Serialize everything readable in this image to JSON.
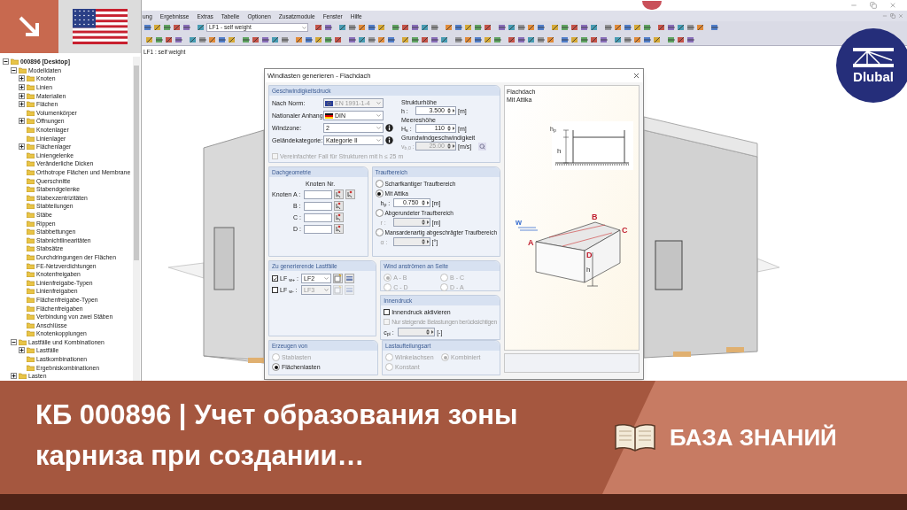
{
  "menu": [
    "ung",
    "Ergebnisse",
    "Extras",
    "Tabelle",
    "Optionen",
    "Zusatzmodule",
    "Fenster",
    "Hilfe"
  ],
  "load_case_select": "LF1 - self weight",
  "view_label": "LF1 : self weight",
  "tree": [
    {
      "label": "000896 [Desktop]",
      "expanded": true,
      "children": [
        {
          "label": "Modelldaten",
          "expanded": true,
          "children": [
            {
              "label": "Knoten",
              "expanded": false
            },
            {
              "label": "Linien",
              "expanded": false
            },
            {
              "label": "Materialien",
              "expanded": false
            },
            {
              "label": "Flächen",
              "expanded": false
            },
            {
              "label": "Volumenkörper"
            },
            {
              "label": "Öffnungen",
              "expanded": false
            },
            {
              "label": "Knotenlager"
            },
            {
              "label": "Linienlager"
            },
            {
              "label": "Flächenlager",
              "expanded": false
            },
            {
              "label": "Liniengelenke"
            },
            {
              "label": "Veränderliche Dicken"
            },
            {
              "label": "Orthotrope Flächen und Membrane"
            },
            {
              "label": "Querschnitte"
            },
            {
              "label": "Stabendgelenke"
            },
            {
              "label": "Stabexzentrizitäten"
            },
            {
              "label": "Stabteilungen"
            },
            {
              "label": "Stäbe"
            },
            {
              "label": "Rippen"
            },
            {
              "label": "Stabbettungen"
            },
            {
              "label": "Stabnichtlinearitäten"
            },
            {
              "label": "Stabsätze"
            },
            {
              "label": "Durchdringungen der Flächen"
            },
            {
              "label": "FE-Netzverdichtungen"
            },
            {
              "label": "Knotenfreigaben"
            },
            {
              "label": "Linienfreigabe-Typen"
            },
            {
              "label": "Linienfreigaben"
            },
            {
              "label": "Flächenfreigabe-Typen"
            },
            {
              "label": "Flächenfreigaben"
            },
            {
              "label": "Verbindung von zwei Stäben"
            },
            {
              "label": "Anschlüsse"
            },
            {
              "label": "Knotenkopplungen"
            }
          ]
        },
        {
          "label": "Lastfälle und Kombinationen",
          "expanded": true,
          "children": [
            {
              "label": "Lastfälle",
              "expanded": false
            },
            {
              "label": "Lastkombinationen"
            },
            {
              "label": "Ergebniskombinationen"
            }
          ]
        },
        {
          "label": "Lasten",
          "expanded": false
        }
      ]
    }
  ],
  "dialog": {
    "title": "Windlasten generieren  -  Flachdach",
    "speed_pressure": {
      "title": "Geschwindigkeitsdruck",
      "norm": {
        "label": "Nach Norm:",
        "value": "EN 1991-1-4",
        "disabled": true
      },
      "annex": {
        "label": "Nationaler Anhang:",
        "value": "DIN"
      },
      "windzone": {
        "label": "Windzone:",
        "value": "2"
      },
      "terrain": {
        "label": "Geländekategorie:",
        "value": "Kategorie II"
      },
      "simplified": {
        "label": "Vereinfachter Fall für Strukturen mit h ≤ 25 m",
        "checked": false,
        "disabled": true
      },
      "height": {
        "caption": "Strukturhöhe",
        "label": "h :",
        "value": "3.500",
        "unit": "[m]"
      },
      "altitude": {
        "caption": "Meereshöhe",
        "label": "H$_{s}$ :",
        "value": "110",
        "unit": "[m]"
      },
      "wind_speed": {
        "caption": "Grundwindgeschwindigkeit",
        "label": "v$_{b,0}$ :",
        "value": "25.00",
        "unit": "[m/s]",
        "disabled": true
      }
    },
    "roof_geometry": {
      "title": "Dachgeometrie",
      "column": "Knoten Nr.",
      "row_label": "Knoten",
      "nodes": [
        {
          "label": "A :"
        },
        {
          "label": "B :"
        },
        {
          "label": "C :"
        },
        {
          "label": "D :"
        }
      ]
    },
    "eave": {
      "title": "Traufbereich",
      "options": [
        {
          "label": "Scharfkantiger Traufbereich",
          "selected": false
        },
        {
          "label": "Mit Attika",
          "selected": true,
          "field": {
            "label": "h$_{p}$ :",
            "value": "0.750",
            "unit": "[m]",
            "disabled": false
          }
        },
        {
          "label": "Abgerundeter Traufbereich",
          "selected": false,
          "field": {
            "label": "r :",
            "unit": "[m]",
            "disabled": true
          }
        },
        {
          "label": "Mansardenartig abgeschrägter Traufbereich",
          "selected": false,
          "field": {
            "label": "α :",
            "unit": "[°]",
            "disabled": true
          }
        }
      ]
    },
    "load_cases": {
      "title": "Zu generierende Lastfälle",
      "rows": [
        {
          "label": "LF $_{w+}$ :",
          "checked": true,
          "value": "LF2"
        },
        {
          "label": "LF $_{w-}$ :",
          "checked": false,
          "value": "LF3"
        }
      ]
    },
    "wind_side": {
      "title": "Wind anströmen an Seite",
      "disabled": true,
      "options": [
        {
          "label": "A - B",
          "selected": true
        },
        {
          "label": "B - C",
          "selected": false
        },
        {
          "label": "C - D",
          "selected": false
        },
        {
          "label": "D - A",
          "selected": false
        }
      ]
    },
    "internal_pressure": {
      "title": "Innendruck",
      "activate": {
        "label": "Innendruck aktivieren",
        "checked": false
      },
      "increasing": {
        "label": "Nur steigende Belastungen berücksichtigen",
        "checked": false,
        "disabled": true
      },
      "cpi": {
        "label": "c$_{pi}$ :",
        "unit": "[-]",
        "disabled": true
      }
    },
    "generate": {
      "title": "Erzeugen von",
      "options": [
        {
          "label": "Stablasten",
          "selected": false,
          "disabled": true
        },
        {
          "label": "Flächenlasten",
          "selected": true,
          "disabled": false
        }
      ]
    },
    "distribution": {
      "title": "Lastaufteilungsart",
      "disabled": true,
      "options": [
        {
          "label": "Winkelachsen",
          "selected": false
        },
        {
          "label": "Kombiniert",
          "selected": true
        },
        {
          "label": "Konstant",
          "selected": false
        }
      ]
    },
    "preview": {
      "lines": [
        "Flachdach",
        "Mit Attika"
      ],
      "section_labels": [
        "h$_{p}$",
        "h"
      ],
      "points": [
        "A",
        "B",
        "C",
        "D"
      ],
      "wind": "w",
      "height": "h"
    }
  },
  "logo": "Dlubal",
  "banner": {
    "title": "КБ 000896 | Учет образования зоны карниза при создании…",
    "category": "БАЗА ЗНАНИЙ"
  }
}
